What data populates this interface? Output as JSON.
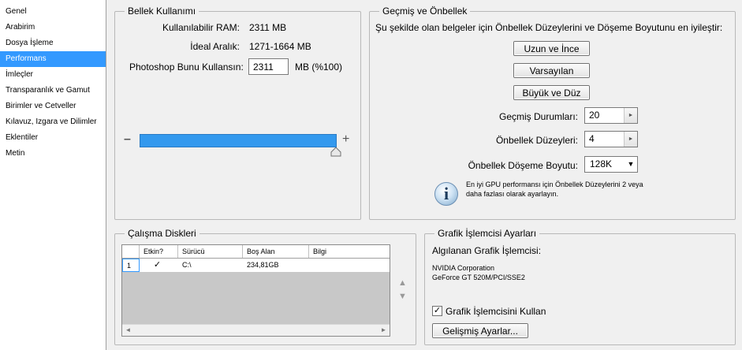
{
  "sidebar": {
    "items": [
      {
        "label": "Genel"
      },
      {
        "label": "Arabirim"
      },
      {
        "label": "Dosya İşleme"
      },
      {
        "label": "Performans"
      },
      {
        "label": "İmleçler"
      },
      {
        "label": "Transparanlık ve Gamut"
      },
      {
        "label": "Birimler ve Cetveller"
      },
      {
        "label": "Kılavuz, Izgara ve Dilimler"
      },
      {
        "label": "Eklentiler"
      },
      {
        "label": "Metin"
      }
    ],
    "active_index": 3
  },
  "memory": {
    "title": "Bellek Kullanımı",
    "available_label": "Kullanılabilir RAM:",
    "available_value": "2311 MB",
    "ideal_label": "İdeal Aralık:",
    "ideal_value": "1271-1664 MB",
    "use_label": "Photoshop Bunu Kullansın:",
    "use_value": "2311",
    "use_suffix": "MB (%100)",
    "minus": "–",
    "plus": "+",
    "slider_fraction": 1.0
  },
  "history": {
    "title": "Geçmiş ve Önbellek",
    "description": "Şu şekilde olan belgeler için Önbellek Düzeylerini ve Döşeme Boyutunu en iyileştir:",
    "btn_tall": "Uzun ve İnce",
    "btn_default": "Varsayılan",
    "btn_big": "Büyük ve Düz",
    "history_label": "Geçmiş Durumları:",
    "history_value": "20",
    "cache_levels_label": "Önbellek Düzeyleri:",
    "cache_levels_value": "4",
    "tile_label": "Önbellek Döşeme Boyutu:",
    "tile_value": "128K",
    "info_glyph": "i",
    "info_text": "En iyi GPU performansı için Önbellek Düzeylerini 2 veya daha fazlası olarak ayarlayın."
  },
  "scratch": {
    "title": "Çalışma Diskleri",
    "columns": [
      "Etkin?",
      "Sürücü",
      "Boş Alan",
      "Bilgi"
    ],
    "rows": [
      {
        "num": "1",
        "active": "✓",
        "drive": "C:\\",
        "free": "234,81GB",
        "info": ""
      }
    ],
    "up_arrow": "▲",
    "down_arrow": "▼",
    "left_arrow": "◄",
    "right_arrow": "►"
  },
  "gpu": {
    "title": "Grafik İşlemcisi Ayarları",
    "detected_label": "Algılanan Grafik İşlemcisi:",
    "vendor": "NVIDIA Corporation",
    "model": "GeForce GT 520M/PCI/SSE2",
    "use_gpu_label": "Grafik İşlemcisini Kullan",
    "use_gpu_check": "✓",
    "advanced_label": "Gelişmiş Ayarlar..."
  },
  "colors": {
    "accent": "#3399ff",
    "slider": "#3399ee"
  }
}
